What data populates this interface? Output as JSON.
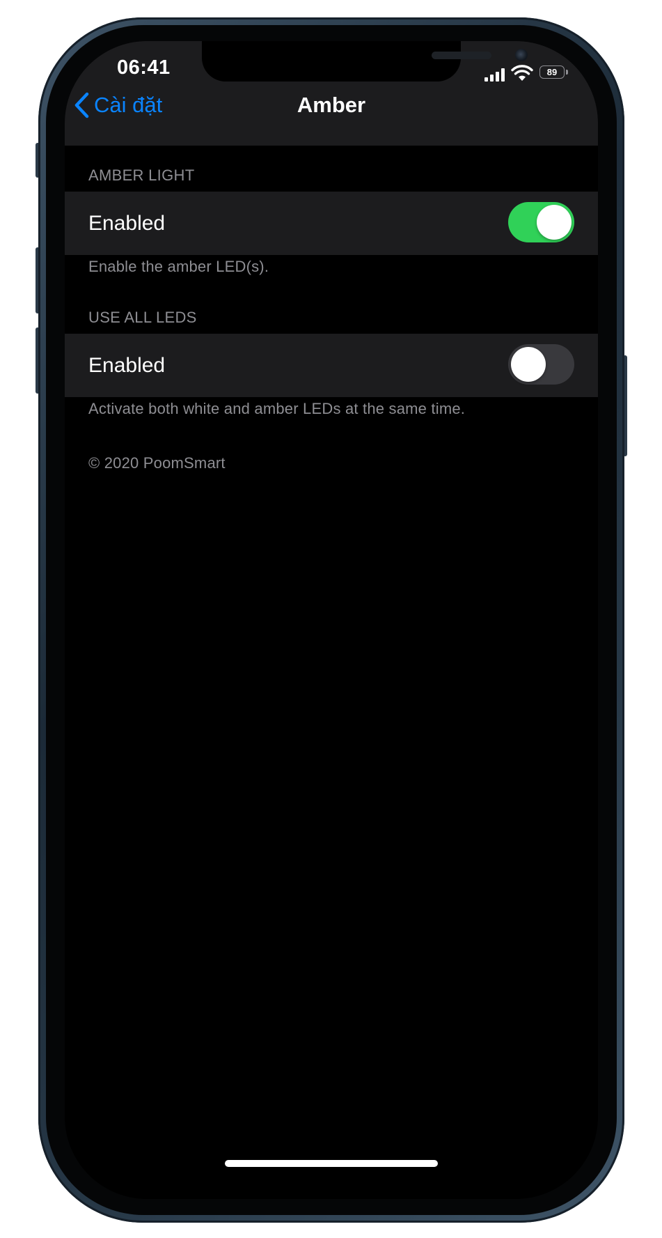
{
  "status_bar": {
    "time": "06:41",
    "battery_level": "89",
    "signal_icon": "cellular-signal-icon",
    "wifi_icon": "wifi-icon",
    "battery_icon": "battery-icon"
  },
  "nav": {
    "back_label": "Cài đặt",
    "back_icon": "chevron-left-icon",
    "title": "Amber"
  },
  "sections": [
    {
      "header": "AMBER LIGHT",
      "row_label": "Enabled",
      "toggle_on": true,
      "footer": "Enable the amber LED(s)."
    },
    {
      "header": "USE ALL LEDS",
      "row_label": "Enabled",
      "toggle_on": false,
      "footer": "Activate both white and amber LEDs at the same time."
    }
  ],
  "copyright": "© 2020 PoomSmart",
  "colors": {
    "accent": "#0a84ff",
    "toggle_on": "#30d158",
    "toggle_off": "#39393d",
    "cell_background": "#1c1c1e",
    "screen_background": "#000000",
    "secondary_text": "#8e8e93"
  }
}
